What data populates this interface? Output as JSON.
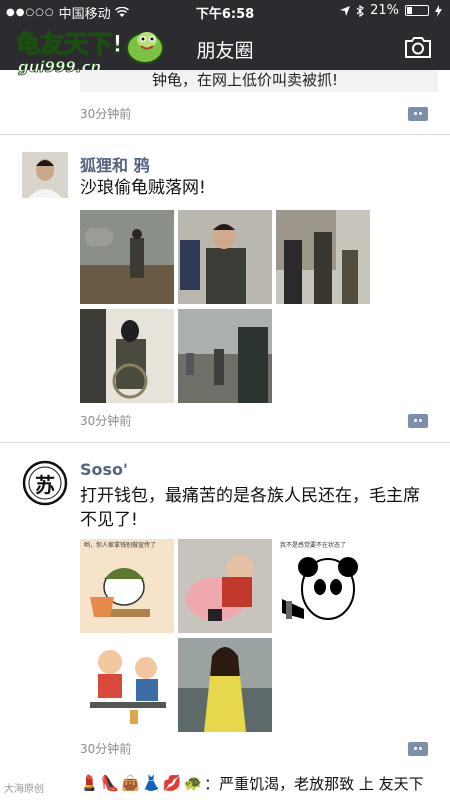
{
  "status_bar": {
    "signal_dots": "●●○○○",
    "carrier": "中国移动",
    "time": "下午6:58",
    "battery_pct": "21%"
  },
  "nav": {
    "title": "朋友圈",
    "camera_icon": "camera-icon"
  },
  "watermark": {
    "brand": "龟友天下!",
    "url": "gui999.cn"
  },
  "posts": [
    {
      "text_tail": "钟龟，在网上低价叫卖被抓!",
      "time": "30分钟前"
    },
    {
      "author": "狐狸和  鸦",
      "text": "沙琅偷龟贼落网!",
      "time": "30分钟前"
    },
    {
      "author": "Soso'",
      "text": "打开钱包，最痛苦的是各族人民还在，毛主席不见了!",
      "time": "30分钟前",
      "avatar_char": "苏"
    }
  ],
  "meme_captions": {
    "m1": "哟，你人家拿钱别做宣传了",
    "m3": "我不是感觉要不在状态了"
  },
  "bottom_strip": {
    "text": "：严重饥渴，老放那致  上  友天下"
  },
  "footer_mark": "大海原创"
}
